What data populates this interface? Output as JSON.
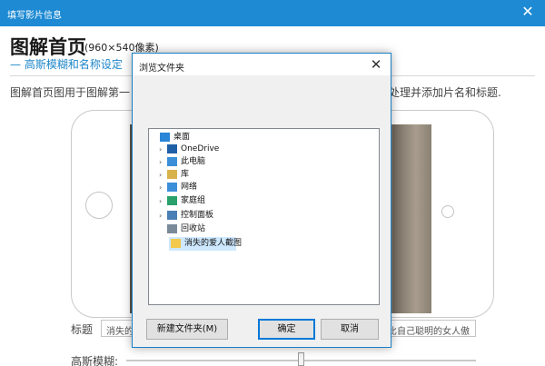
{
  "window": {
    "title": "填写影片信息",
    "close_glyph": "✕"
  },
  "page": {
    "title": "图解首页",
    "size_note": "(960×540像素)",
    "subtitle": "— 高斯模糊和名称设定 〈",
    "description_left": "图解首页图用于图解第一",
    "description_right": "处理并添加片名和标题."
  },
  "form": {
    "title_label": "标题",
    "title_value_left": "消失的",
    "title_value_right": "比自己聪明的女人傲",
    "blur_label": "高斯模糊:",
    "blur_level": 0.5
  },
  "dialog": {
    "title": "浏览文件夹",
    "close_glyph": "✕",
    "tree": [
      {
        "label": "桌面",
        "icon": "desktop-folder-icon",
        "color": "#2a86d6",
        "expander": "",
        "selected": false
      },
      {
        "label": "OneDrive",
        "icon": "cloud-icon",
        "color": "#1f5fa8",
        "expander": "›",
        "selected": false
      },
      {
        "label": "此电脑",
        "icon": "computer-icon",
        "color": "#3b8fd9",
        "expander": "›",
        "selected": false
      },
      {
        "label": "库",
        "icon": "library-icon",
        "color": "#d8b24a",
        "expander": "›",
        "selected": false
      },
      {
        "label": "网络",
        "icon": "network-icon",
        "color": "#3b8fd9",
        "expander": "›",
        "selected": false
      },
      {
        "label": "家庭组",
        "icon": "homegroup-icon",
        "color": "#2aa06a",
        "expander": "›",
        "selected": false
      },
      {
        "label": "控制面板",
        "icon": "control-panel-icon",
        "color": "#4a7fb5",
        "expander": "›",
        "selected": false
      },
      {
        "label": "回收站",
        "icon": "recycle-bin-icon",
        "color": "#7a8a99",
        "expander": "",
        "selected": false
      },
      {
        "label": "消失的爱人截图",
        "icon": "folder-icon",
        "color": "#f2c94c",
        "expander": "",
        "selected": true
      }
    ],
    "buttons": {
      "new_folder": "新建文件夹(M)",
      "ok": "确定",
      "cancel": "取消"
    }
  },
  "colors": {
    "accent": "#1d8ad3",
    "selection": "#cde8ff"
  }
}
